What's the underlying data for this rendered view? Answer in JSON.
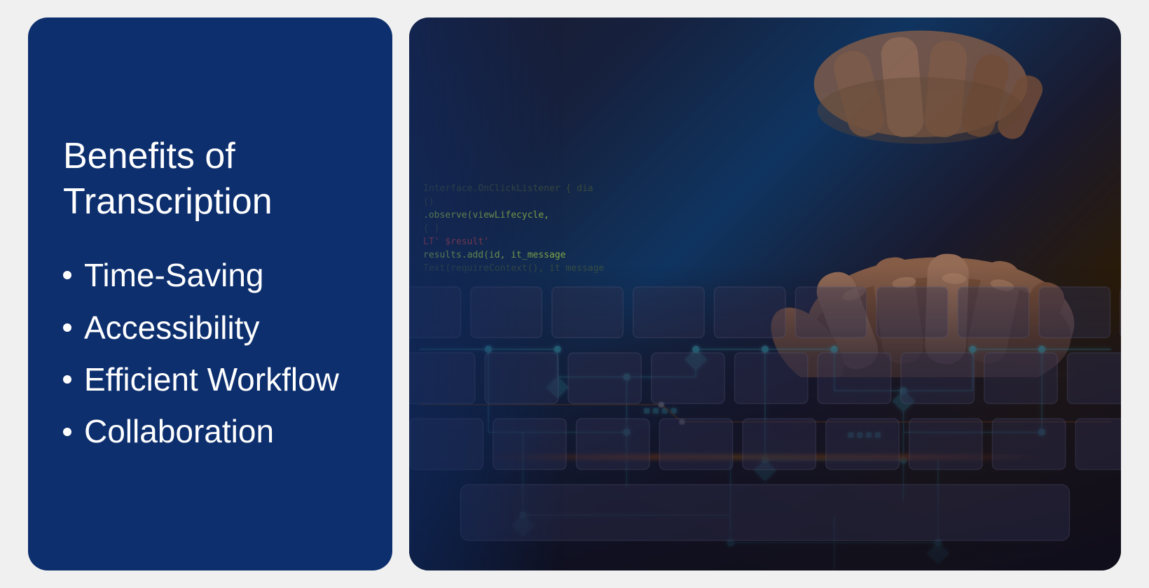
{
  "left": {
    "title_line1": "Benefits of",
    "title_line2": "Transcription",
    "bullets": [
      {
        "id": "time-saving",
        "label": "Time-Saving"
      },
      {
        "id": "accessibility",
        "label": "Accessibility"
      },
      {
        "id": "efficient-workflow",
        "label": "Efficient Workflow"
      },
      {
        "id": "collaboration",
        "label": "Collaboration"
      }
    ]
  },
  "right": {
    "alt_text": "Hands typing on keyboard with glowing circuit board overlay and code in background"
  },
  "colors": {
    "panel_bg": "#0d2f6e",
    "text_white": "#ffffff",
    "accent_cyan": "#4af0ff",
    "accent_orange": "#ff7700"
  },
  "code_lines": [
    {
      "text": "Interface.OnClickListener { dia",
      "style": "dim"
    },
    {
      "text": "()",
      "style": "dim"
    },
    {
      "text": ".observe(viewLifecycle,",
      "style": "normal"
    },
    {
      "text": "{ )",
      "style": "dim"
    },
    {
      "text": "LT'  $result'",
      "style": "red"
    },
    {
      "text": "results.add(id, it_message",
      "style": "normal"
    },
    {
      "text": "Text(requireContext(), it message ",
      "style": "dim"
    }
  ]
}
